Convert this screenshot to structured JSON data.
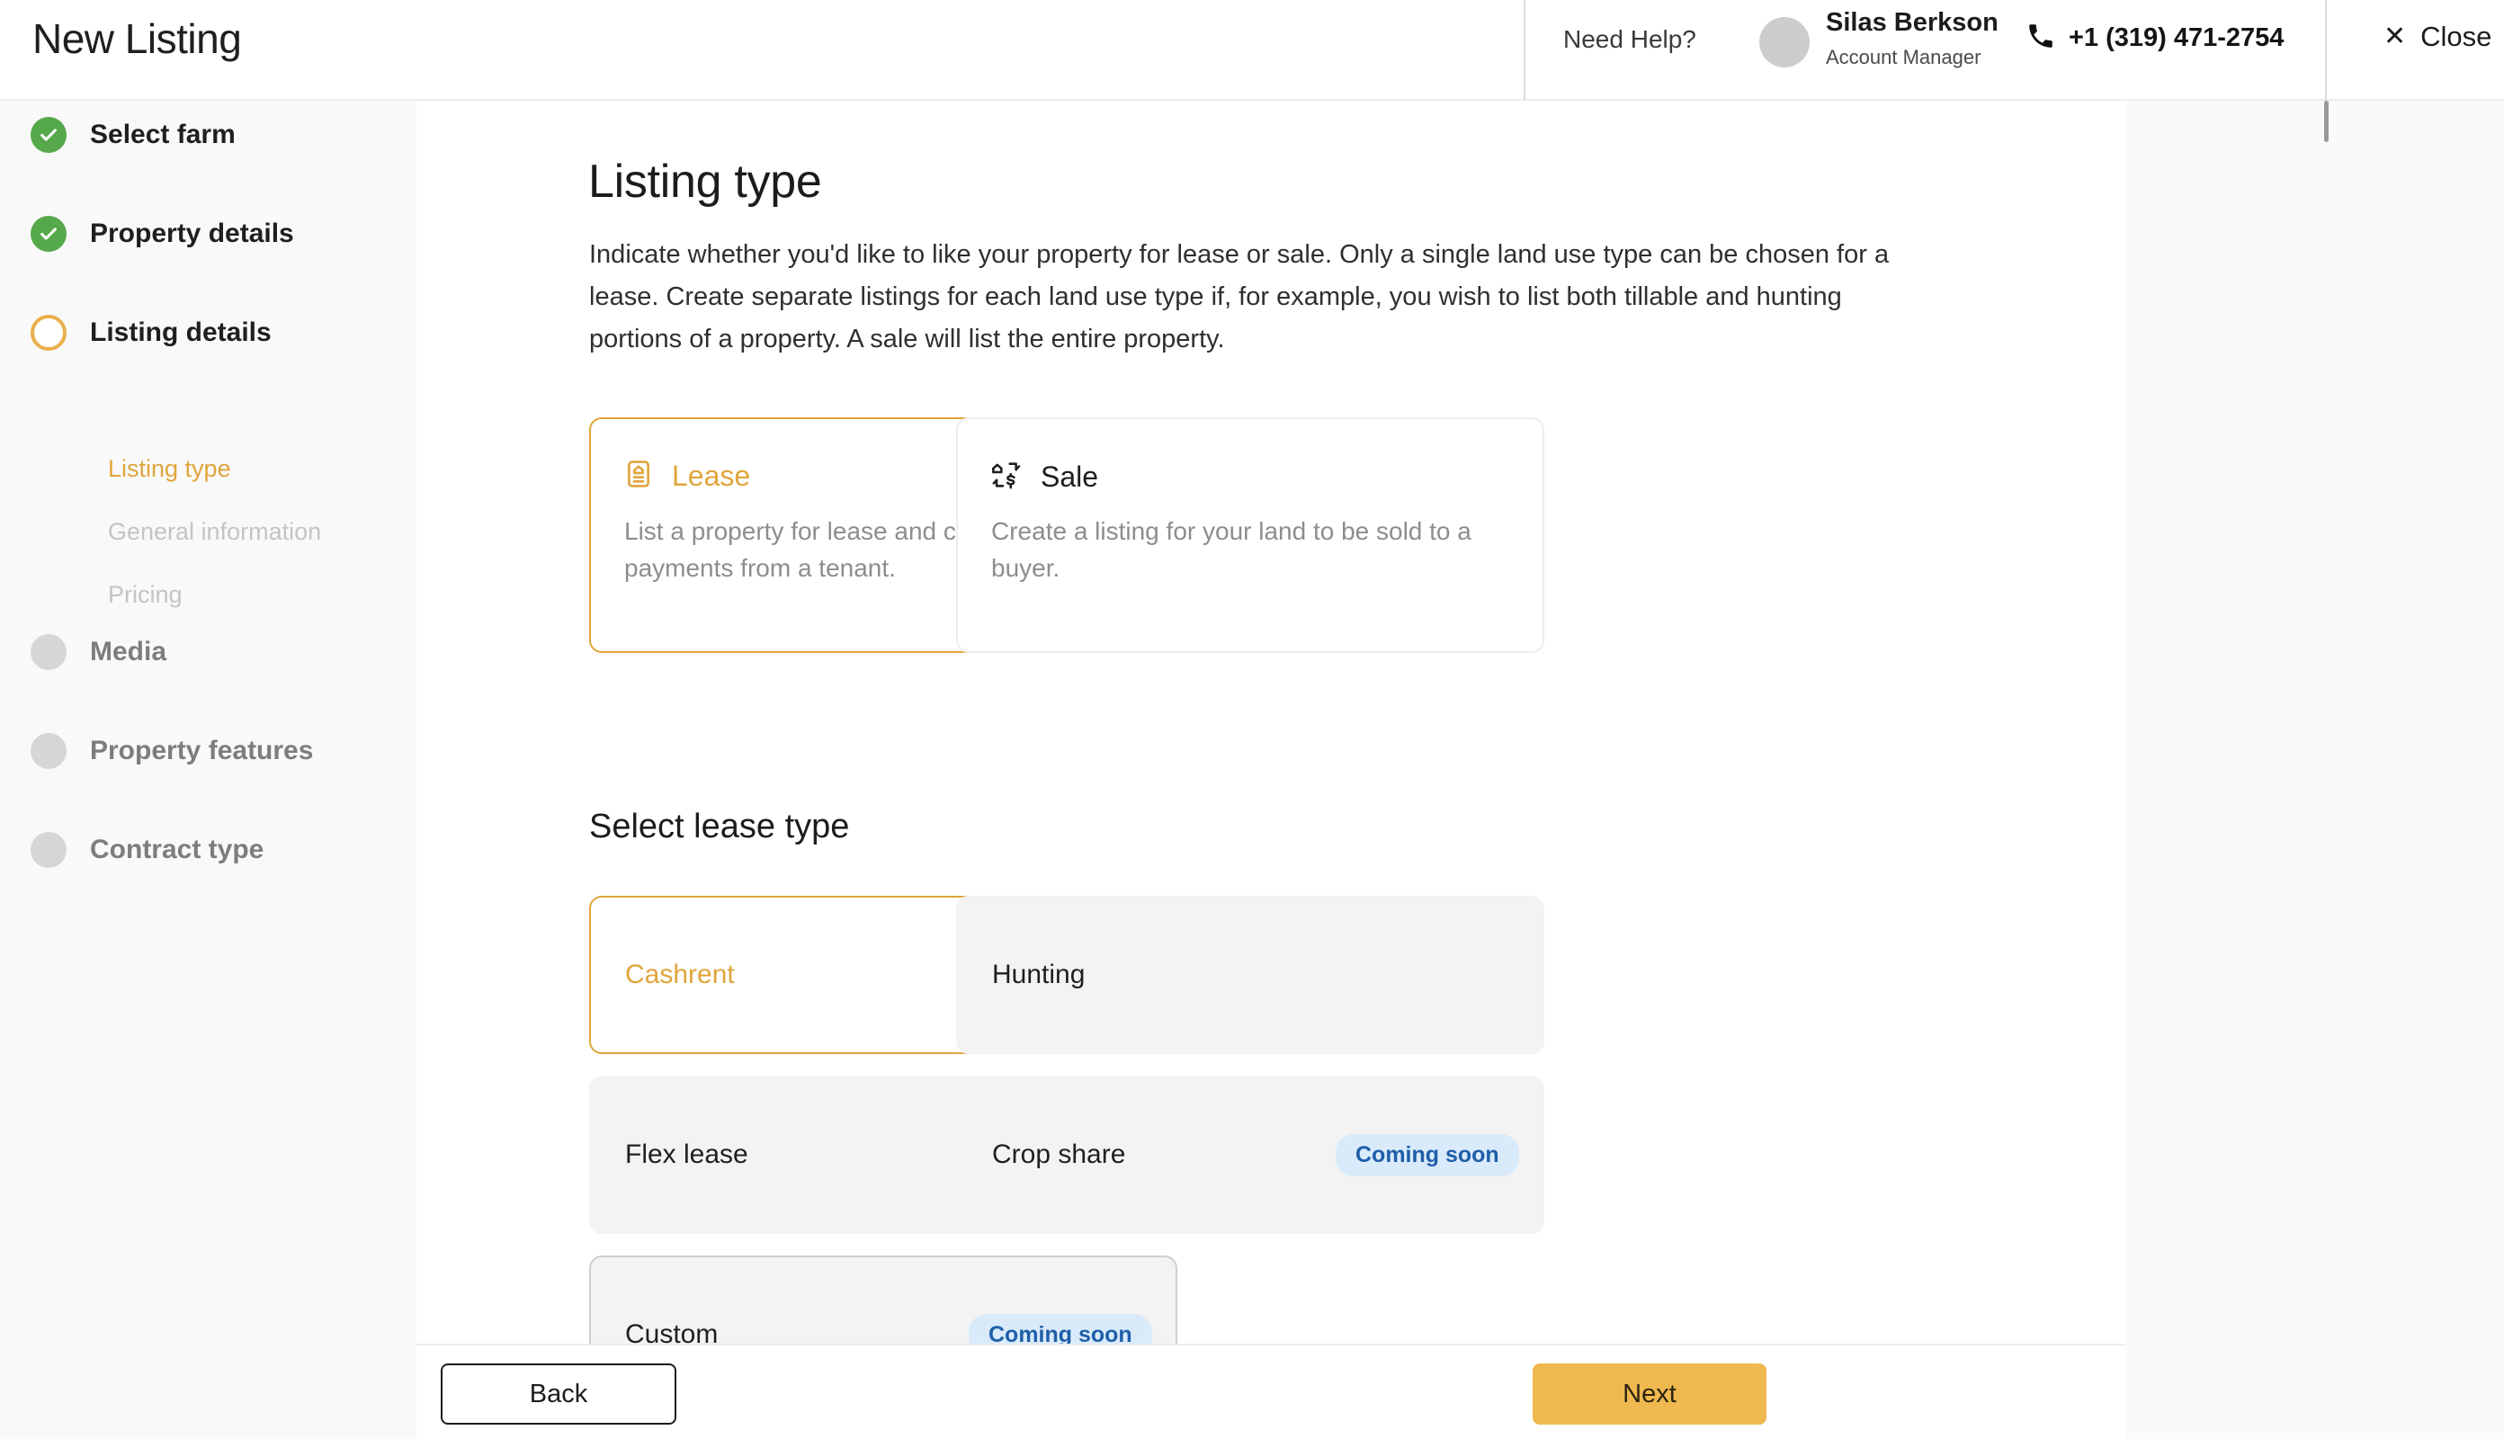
{
  "header": {
    "title": "New Listing",
    "need_help": "Need Help?",
    "agent_name": "Silas Berkson",
    "agent_role": "Account Manager",
    "phone": "+1 (319) 471-2754",
    "close_label": "Close",
    "close_x": "✕"
  },
  "sidebar": {
    "steps": [
      {
        "label": "Select farm",
        "state": "done"
      },
      {
        "label": "Property details",
        "state": "done"
      },
      {
        "label": "Listing details",
        "state": "active"
      },
      {
        "label": "Media",
        "state": "todo"
      },
      {
        "label": "Property features",
        "state": "todo"
      },
      {
        "label": "Contract type",
        "state": "todo"
      }
    ],
    "substeps": [
      {
        "label": "Listing type",
        "state": "current"
      },
      {
        "label": "General information",
        "state": "muted"
      },
      {
        "label": "Pricing",
        "state": "muted"
      }
    ]
  },
  "main": {
    "title": "Listing type",
    "description": "Indicate whether you'd like to like your property for lease or sale. Only a single land use type can be chosen for a lease. Create separate listings for each land use type if, for example, you wish to list both tillable and hunting portions of a property. A sale will list the entire property.",
    "listing_types": [
      {
        "name": "Lease",
        "description": "List a property for lease and collect rent payments from a tenant.",
        "icon": "lease-document-icon",
        "selected": true
      },
      {
        "name": "Sale",
        "description": "Create a listing for your land to be sold to a buyer.",
        "icon": "house-exchange-dollar-icon",
        "selected": false
      }
    ],
    "section_title": "Select lease type",
    "lease_types": [
      {
        "label": "Cashrent",
        "selected": true,
        "badge": null
      },
      {
        "label": "Hunting",
        "selected": false,
        "badge": null
      },
      {
        "label": "Flex lease",
        "selected": false,
        "badge": "Coming soon"
      },
      {
        "label": "Crop share",
        "selected": false,
        "badge": "Coming soon"
      },
      {
        "label": "Custom",
        "selected": false,
        "badge": "Coming soon"
      }
    ]
  },
  "footer": {
    "back_label": "Back",
    "next_label": "Next"
  },
  "colors": {
    "accent": "#e0a53c",
    "accent_button": "#efb94f",
    "success": "#56a94b",
    "badge_bg": "#d9ebfb",
    "badge_text": "#1f5fa8"
  }
}
